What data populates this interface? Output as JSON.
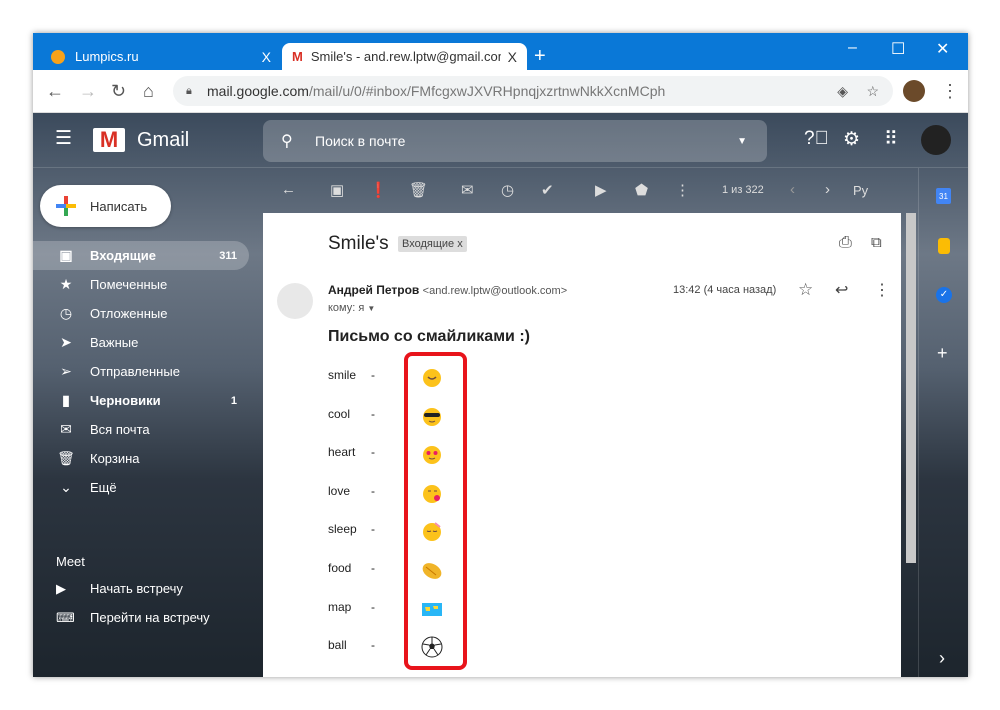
{
  "browser": {
    "tabs": [
      {
        "label": "Lumpics.ru",
        "close": "X"
      },
      {
        "label": "Smile's - and.rew.lptw@gmail.com",
        "close": "X"
      }
    ],
    "new_tab": "+",
    "url_host": "mail.google.com",
    "url_path": "/mail/u/0/#inbox/FMfcgxwJXVRHpnqjxzrtnwNkkXcnMCph",
    "window_controls": [
      "–",
      "☐",
      "✕"
    ]
  },
  "gmail": {
    "logo": "Gmail",
    "search_placeholder": "Поиск в почте",
    "compose": "Написать",
    "sidebar": [
      {
        "label": "Входящие",
        "count": "311",
        "icon": "inbox-icon"
      },
      {
        "label": "Помеченные",
        "icon": "star-icon"
      },
      {
        "label": "Отложенные",
        "icon": "clock-icon"
      },
      {
        "label": "Важные",
        "icon": "important-icon"
      },
      {
        "label": "Отправленные",
        "icon": "send-icon"
      },
      {
        "label": "Черновики",
        "count": "1",
        "icon": "draft-icon"
      },
      {
        "label": "Вся почта",
        "icon": "mail-icon"
      },
      {
        "label": "Корзина",
        "icon": "trash-icon"
      },
      {
        "label": "Ещё",
        "icon": "chevron-down-icon"
      }
    ],
    "meet": {
      "title": "Meet",
      "items": [
        "Начать встречу",
        "Перейти на встречу"
      ]
    },
    "pager": "1 из 322",
    "lang": "Ру"
  },
  "email": {
    "subject": "Smile's",
    "label": "Входящие",
    "label_close": "x",
    "sender_name": "Андрей Петров",
    "sender_email": "<and.rew.lptw@outlook.com>",
    "to": "кому: я",
    "time": "13:42 (4 часа назад)",
    "heading": "Письмо со смайликами :)",
    "rows": [
      {
        "name": "smile",
        "dash": "-",
        "emoji": "smile"
      },
      {
        "name": "cool",
        "dash": "-",
        "emoji": "cool"
      },
      {
        "name": "heart",
        "dash": "-",
        "emoji": "heart"
      },
      {
        "name": "love",
        "dash": "-",
        "emoji": "love"
      },
      {
        "name": "sleep",
        "dash": "-",
        "emoji": "sleep"
      },
      {
        "name": "food",
        "dash": "-",
        "emoji": "food"
      },
      {
        "name": "map",
        "dash": "-",
        "emoji": "map"
      },
      {
        "name": "ball",
        "dash": "-",
        "emoji": "ball"
      }
    ]
  },
  "colors": {
    "chrome": "#0a78d7",
    "highlight": "#e8141b",
    "emoji": "#fcc21b"
  }
}
